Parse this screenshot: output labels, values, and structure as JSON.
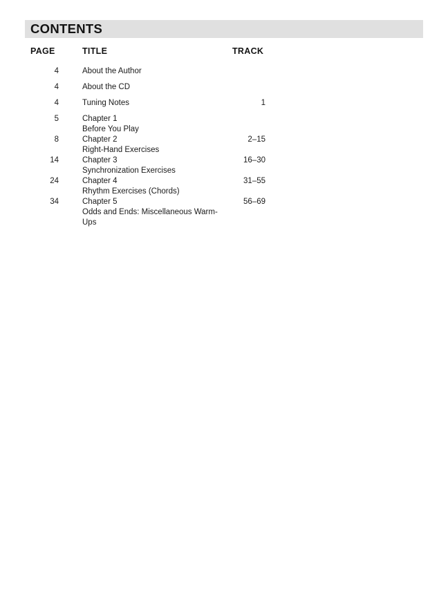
{
  "banner": {
    "title": "CONTENTS",
    "background_color": "#e0e0e0"
  },
  "columns": {
    "page": "PAGE",
    "title": "TITLE",
    "track": "TRACK"
  },
  "rows": [
    {
      "page": "4",
      "title": "About the Author",
      "subtitle": "",
      "track": "",
      "spaced": false
    },
    {
      "page": "4",
      "title": "About the CD",
      "subtitle": "",
      "track": "",
      "spaced": false
    },
    {
      "page": "4",
      "title": "Tuning Notes",
      "subtitle": "",
      "track": "1",
      "spaced": false
    },
    {
      "page": "5",
      "title": "Chapter 1",
      "subtitle": "Before You Play",
      "track": "",
      "spaced": false
    },
    {
      "page": "8",
      "title": "Chapter 2",
      "subtitle": "Right-Hand Exercises",
      "track": "2–15",
      "spaced": true
    },
    {
      "page": "14",
      "title": "Chapter 3",
      "subtitle": "Synchronization Exercises",
      "track": "16–30",
      "spaced": true
    },
    {
      "page": "24",
      "title": "Chapter 4",
      "subtitle": "Rhythm Exercises (Chords)",
      "track": "31–55",
      "spaced": true
    },
    {
      "page": "34",
      "title": "Chapter 5",
      "subtitle": "Odds and Ends: Miscellaneous Warm-Ups",
      "track": "56–69",
      "spaced": true
    }
  ]
}
